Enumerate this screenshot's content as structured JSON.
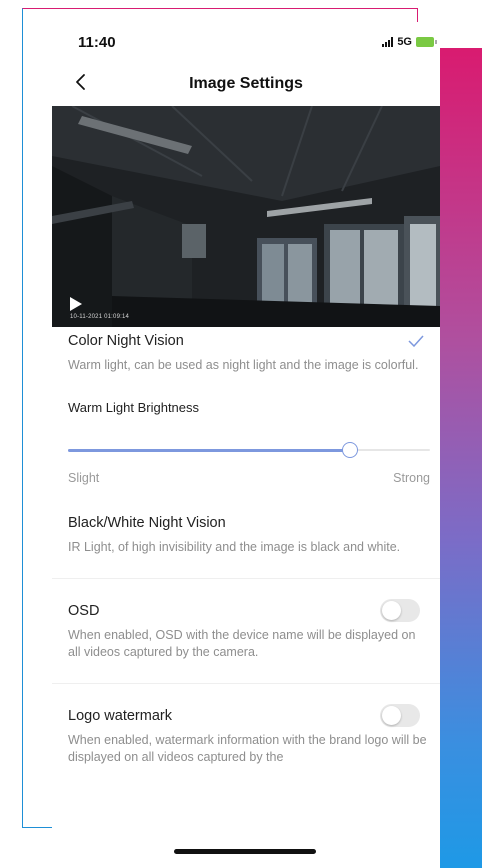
{
  "status_bar": {
    "time": "11:40",
    "network": "5G"
  },
  "nav": {
    "title": "Image Settings"
  },
  "video": {
    "timestamp": "10-11-2021 01:09:14"
  },
  "color_night_vision": {
    "title": "Color Night Vision",
    "description": "Warm light, can be used as night light and the image is colorful.",
    "selected": true
  },
  "warm_light": {
    "label": "Warm Light Brightness",
    "level": 0.78,
    "min_label": "Slight",
    "max_label": "Strong"
  },
  "bw_night_vision": {
    "title": "Black/White Night Vision",
    "description": "IR Light, of high invisibility and the image is black and white."
  },
  "osd": {
    "title": "OSD",
    "description": "When enabled, OSD with the device name will be displayed on all videos captured by the camera.",
    "enabled": false
  },
  "logo_watermark": {
    "title": "Logo watermark",
    "description": "When enabled, watermark information with the brand logo will be displayed on all videos captured by the",
    "enabled": false
  },
  "colors": {
    "accent": "#7d98de",
    "text_primary": "#222222",
    "text_secondary": "#8e8e8e"
  }
}
